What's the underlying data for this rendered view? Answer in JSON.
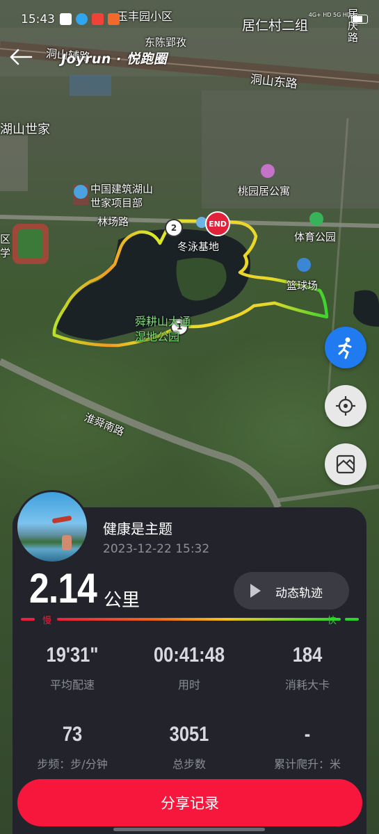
{
  "status_bar": {
    "time": "15:43",
    "network": "4G+ HD 5G HD"
  },
  "header": {
    "brand": "Joyrun · 悦跑圈"
  },
  "map": {
    "labels": {
      "yufeng": "玉丰园小区",
      "dongchen": "东陈郢孜",
      "juren": "居仁村二组",
      "juqing": "居庆路",
      "dongshan_east": "洞山东路",
      "dongshan_fu": "洞山辅路",
      "hushan": "湖山世家",
      "jianzhu": "中国建筑湖山\n世家项目部",
      "taoyuan": "桃园居公寓",
      "linchang": "林场路",
      "dongyong": "冬泳基地",
      "tiyu": "体育公园",
      "lanqiu": "篮球场",
      "shungeng": "舜耕山大通\n湿地公园",
      "huaishun": "淮舜南路",
      "qu": "区\n学",
      "end_marker": "END",
      "marker_1": "1",
      "marker_2": "2"
    }
  },
  "activity": {
    "title": "健康是主题",
    "datetime": "2023-12-22 15:32",
    "distance": "2.14",
    "distance_unit": "公里",
    "replay_label": "动态轨迹",
    "slow_label": "慢",
    "fast_label": "快"
  },
  "stats": [
    {
      "value": "19'31\"",
      "label": "平均配速"
    },
    {
      "value": "00:41:48",
      "label": "用时"
    },
    {
      "value": "184",
      "label": "消耗大卡"
    },
    {
      "value": "73",
      "label": "步频：步/分钟"
    },
    {
      "value": "3051",
      "label": "总步数"
    },
    {
      "value": "-",
      "label": "累计爬升：米"
    }
  ],
  "share_label": "分享记录",
  "colors": {
    "accent": "#f7173d",
    "run_button": "#1f7bef",
    "card_bg": "#23242b",
    "slow": "#e9213f",
    "fast": "#2bd42c"
  }
}
